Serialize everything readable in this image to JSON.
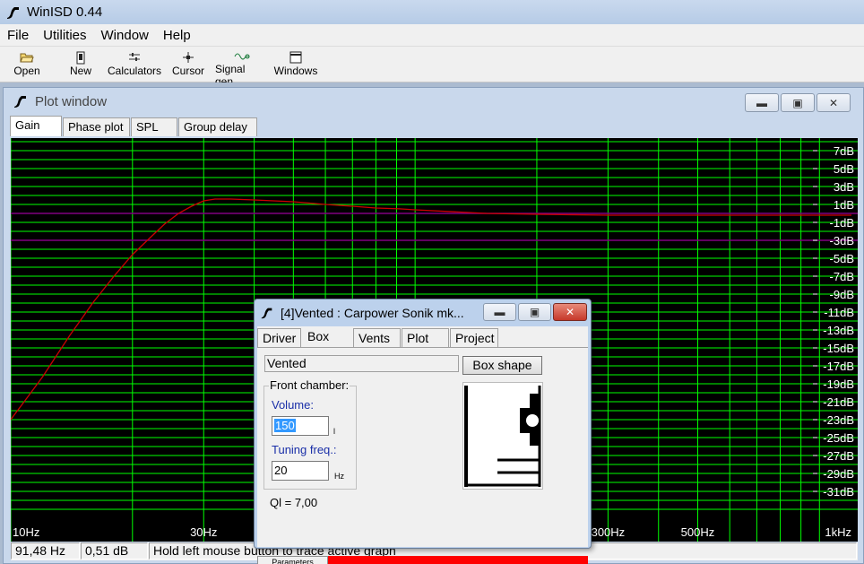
{
  "app": {
    "title": "WinISD 0.44"
  },
  "menu": [
    "File",
    "Utilities",
    "Window",
    "Help"
  ],
  "toolbar": [
    {
      "label": "Open",
      "icon": "open-folder-icon"
    },
    {
      "label": "New",
      "icon": "new-document-icon"
    },
    {
      "label": "Calculators",
      "icon": "calculator-icon"
    },
    {
      "label": "Cursor",
      "icon": "cursor-crosshair-icon"
    },
    {
      "label": "Signal gen.",
      "icon": "signal-generator-icon"
    },
    {
      "label": "Windows",
      "icon": "windows-icon"
    }
  ],
  "plot_window": {
    "title": "Plot window",
    "tabs": [
      "Gain",
      "Phase plot",
      "SPL",
      "Group delay"
    ],
    "active_tab": "Gain"
  },
  "status": {
    "freq": "91,48 Hz",
    "gain": "0,51 dB",
    "hint": "Hold left mouse button to trace active graph"
  },
  "box_dialog": {
    "title": "[4]Vented : Carpower Sonik mk...",
    "tabs": [
      "Driver",
      "Box",
      "Vents",
      "Plot",
      "Project"
    ],
    "active_tab": "Box",
    "box_type": "Vented",
    "box_shape_label": "Box shape",
    "front_chamber_label": "Front chamber:",
    "volume_label": "Volume:",
    "volume_value": "150",
    "volume_unit": "l",
    "tuning_label": "Tuning freq.:",
    "tuning_value": "20",
    "tuning_unit": "Hz",
    "ql_text": "Ql = 7,00",
    "parameters_label": "Parameters"
  },
  "colors": {
    "plot_bg": "#000000",
    "grid": "#00ff00",
    "axis_text": "#ffffff",
    "curve": "#cc0000",
    "reference_line": "#800080",
    "status_red": "#ff0000"
  },
  "chart_data": {
    "type": "line",
    "title": "",
    "xlabel": "",
    "ylabel": "",
    "x_scale": "log",
    "xlim": [
      10,
      1200
    ],
    "ylim": [
      -33,
      8
    ],
    "x_ticks": [
      "10Hz",
      "30Hz",
      "300Hz",
      "500Hz",
      "1kHz"
    ],
    "x_tick_values": [
      10,
      30,
      300,
      500,
      1000
    ],
    "y_ticks": [
      "7dB",
      "5dB",
      "3dB",
      "1dB",
      "-1dB",
      "-3dB",
      "-5dB",
      "-7dB",
      "-9dB",
      "-11dB",
      "-13dB",
      "-15dB",
      "-17dB",
      "-19dB",
      "-21dB",
      "-23dB",
      "-25dB",
      "-27dB",
      "-29dB",
      "-31dB"
    ],
    "y_tick_values": [
      7,
      5,
      3,
      1,
      -1,
      -3,
      -5,
      -7,
      -9,
      -11,
      -13,
      -15,
      -17,
      -19,
      -21,
      -23,
      -25,
      -27,
      -29,
      -31
    ],
    "grid": true,
    "series": [
      {
        "x": [
          10,
          11,
          12,
          13,
          14,
          15,
          16,
          18,
          20,
          22,
          24,
          26,
          28,
          30,
          32,
          35,
          40,
          50,
          60,
          70,
          80,
          91.48,
          100,
          150,
          200,
          300,
          500,
          1000,
          1200
        ],
        "y": [
          -23.0,
          -20.5,
          -18.2,
          -15.8,
          -13.6,
          -11.7,
          -9.9,
          -7.0,
          -4.6,
          -2.8,
          -1.2,
          0.0,
          0.8,
          1.4,
          1.6,
          1.6,
          1.5,
          1.3,
          1.0,
          0.8,
          0.6,
          0.51,
          0.4,
          0.0,
          -0.1,
          -0.2,
          -0.2,
          -0.2,
          -0.2
        ]
      }
    ],
    "reference_lines": [
      0,
      -3
    ]
  }
}
